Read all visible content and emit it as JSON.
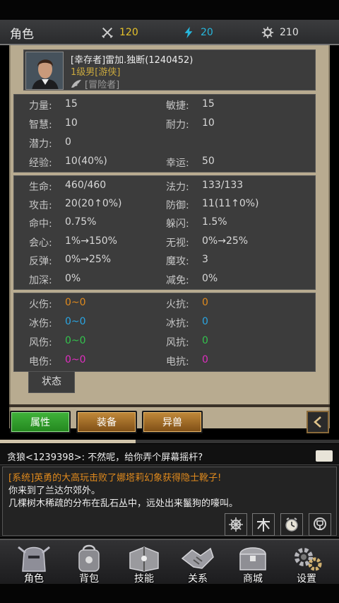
{
  "header": {
    "title": "角色",
    "resources": [
      {
        "icon": "crossed-swords-icon",
        "value": "120",
        "color": "#e5c22a"
      },
      {
        "icon": "lightning-icon",
        "value": "20",
        "color": "#27b7dc"
      },
      {
        "icon": "gear-icon",
        "value": "210",
        "color": "#e0e0e0"
      }
    ]
  },
  "profile": {
    "name": "[幸存者]雷加.独断(1240452)",
    "level_line": "1级男[游侠]",
    "class_tag": "[冒险者]"
  },
  "stats_basic": [
    {
      "l1": "力量:",
      "v1": "15",
      "l2": "敏捷:",
      "v2": "15"
    },
    {
      "l1": "智慧:",
      "v1": "10",
      "l2": "耐力:",
      "v2": "10"
    },
    {
      "l1": "潜力:",
      "v1": "0",
      "l2": "",
      "v2": ""
    },
    {
      "l1": "经验:",
      "v1": "10(40%)",
      "l2": "幸运:",
      "v2": "50"
    }
  ],
  "stats_combat": [
    {
      "l1": "生命:",
      "v1": "460/460",
      "l2": "法力:",
      "v2": "133/133"
    },
    {
      "l1": "攻击:",
      "v1": "20(20↑0%)",
      "l2": "防御:",
      "v2": "11(11↑0%)"
    },
    {
      "l1": "命中:",
      "v1": "0.75%",
      "l2": "躲闪:",
      "v2": "1.5%"
    },
    {
      "l1": "会心:",
      "v1": "1%→150%",
      "l2": "无视:",
      "v2": "0%→25%"
    },
    {
      "l1": "反弹:",
      "v1": "0%→25%",
      "l2": "魔攻:",
      "v2": "3"
    },
    {
      "l1": "加深:",
      "v1": "0%",
      "l2": "减免:",
      "v2": "0%"
    }
  ],
  "stats_element": [
    {
      "l1": "火伤:",
      "v1": "0~0",
      "l2": "火抗:",
      "v2": "0",
      "color": "#e08a1d"
    },
    {
      "l1": "冰伤:",
      "v1": "0~0",
      "l2": "冰抗:",
      "v2": "0",
      "color": "#2aa5e2"
    },
    {
      "l1": "风伤:",
      "v1": "0~0",
      "l2": "风抗:",
      "v2": "0",
      "color": "#33c24d"
    },
    {
      "l1": "电伤:",
      "v1": "0~0",
      "l2": "电抗:",
      "v2": "0",
      "color": "#df2ebf"
    }
  ],
  "status_tab": "状态",
  "tabs": {
    "attributes": "属性",
    "equipment": "装备",
    "beast": "异兽"
  },
  "chat": {
    "top_message": "贪狼<1239398>: 不然呢，给你弄个屏幕摇杆?",
    "system_message": "[系统]英勇的大高玩击败了娜塔莉幻象获得隐士靴子!",
    "line1": "你来到了兰达尔郊外。",
    "line2": "几棵树木稀疏的分布在乱石丛中，远处出来鬣狗的嚎叫。",
    "quick_icons": [
      "ship-wheel-icon",
      "wood-icon",
      "clock-icon",
      "trophy-icon"
    ]
  },
  "nav": {
    "character": "角色",
    "backpack": "背包",
    "skills": "技能",
    "relations": "关系",
    "shop": "商城",
    "settings": "设置"
  },
  "progress": {
    "fraction": 0.4
  }
}
